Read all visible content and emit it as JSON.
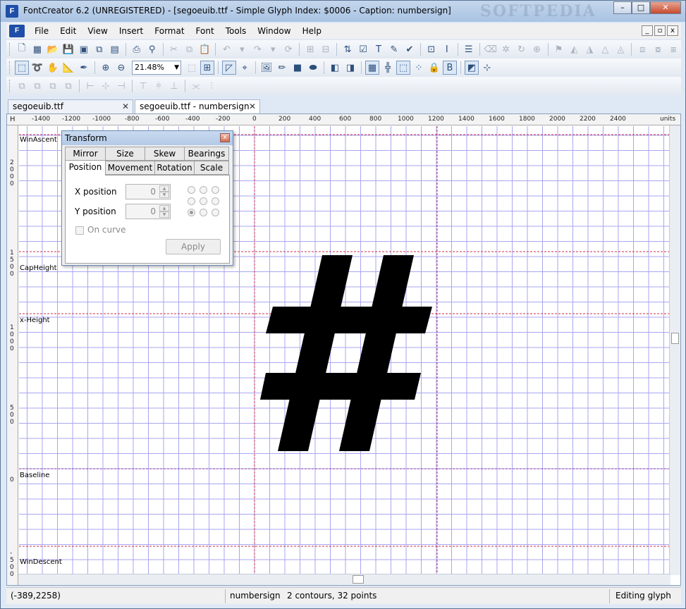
{
  "window": {
    "title": "FontCreator 6.2 (UNREGISTERED) - [segoeuib.ttf - Simple Glyph Index: $0006 - Caption: numbersign]",
    "watermark": "SOFTPEDIA",
    "app_icon_text": "F",
    "minimize": "–",
    "maximize": "□",
    "close": "✕"
  },
  "menu": {
    "logo_text": "F",
    "items": [
      "File",
      "Edit",
      "View",
      "Insert",
      "Format",
      "Font",
      "Tools",
      "Window",
      "Help"
    ],
    "mdi_minimize": "_",
    "mdi_restore": "▫",
    "mdi_close": "x"
  },
  "toolbar": {
    "zoom": "21.48%",
    "zoom_arrow": "▼"
  },
  "tabs": [
    {
      "label": "segoeuib.ttf",
      "close": "✕",
      "active": false
    },
    {
      "label": "segoeuib.ttf - numbersign",
      "close": "✕",
      "active": true
    }
  ],
  "ruler": {
    "h_label": "H",
    "units_label": "units",
    "ticks": [
      "-1400",
      "-1200",
      "-1000",
      "-800",
      "-600",
      "-400",
      "-200",
      "0",
      "200",
      "400",
      "600",
      "800",
      "1000",
      "1200",
      "1400",
      "1600",
      "1800",
      "2000",
      "2200",
      "2400"
    ],
    "v_labels": [
      {
        "digits": [
          "2",
          "0",
          "0",
          "0"
        ]
      },
      {
        "digits": [
          "1",
          "5",
          "0",
          "0"
        ]
      },
      {
        "digits": [
          "1",
          "0",
          "0",
          "0"
        ]
      },
      {
        "digits": [
          "5",
          "0",
          "0"
        ]
      },
      {
        "digits": [
          "0"
        ]
      },
      {
        "digits": [
          "-",
          "5",
          "0",
          "0"
        ]
      }
    ]
  },
  "metrics": {
    "win_ascent": "WinAscent",
    "cap_height": "CapHeight",
    "x_height": "x-Height",
    "baseline": "Baseline",
    "win_descent": "WinDescent"
  },
  "transform_dialog": {
    "title": "Transform",
    "close": "x",
    "tabs_row1": [
      "Mirror",
      "Size",
      "Skew",
      "Bearings"
    ],
    "tabs_row2": [
      "Position",
      "Movement",
      "Rotation",
      "Scale"
    ],
    "active_tab": "Position",
    "x_label": "X position",
    "x_value": "0",
    "y_label": "Y position",
    "y_value": "0",
    "spin_up": "▲",
    "spin_down": "▼",
    "on_curve_label": "On curve",
    "apply_label": "Apply"
  },
  "glyph": {
    "name": "numbersign",
    "fill_color": "#000000"
  },
  "status": {
    "coords": "(-389,2258)",
    "glyph_name": "numbersign",
    "info": "2 contours, 32 points",
    "mode": "Editing glyph"
  },
  "colors": {
    "grid": "#a9a6f0",
    "guide_red": "#c8324a",
    "guide_purple": "#8a3aa6"
  }
}
